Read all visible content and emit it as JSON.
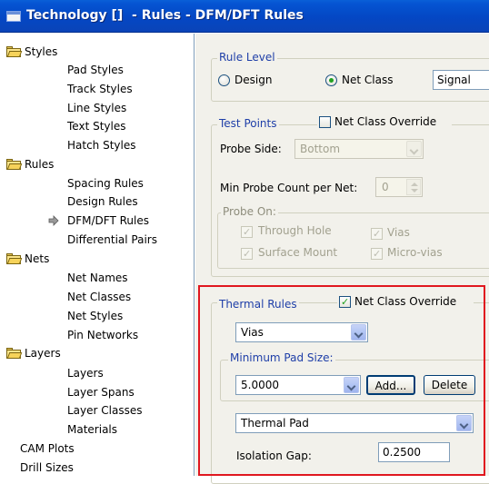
{
  "window": {
    "title": "Technology []  - Rules - DFM/DFT Rules"
  },
  "tree": {
    "styles": "Styles",
    "pad_styles": "Pad Styles",
    "track_styles": "Track Styles",
    "line_styles": "Line Styles",
    "text_styles": "Text Styles",
    "hatch_styles": "Hatch Styles",
    "rules": "Rules",
    "spacing_rules": "Spacing Rules",
    "design_rules": "Design Rules",
    "dfm_dft_rules": "DFM/DFT Rules",
    "differential_pairs": "Differential Pairs",
    "nets": "Nets",
    "net_names": "Net Names",
    "net_classes": "Net Classes",
    "net_styles": "Net Styles",
    "pin_networks": "Pin Networks",
    "layers": "Layers",
    "layers_item": "Layers",
    "layer_spans": "Layer Spans",
    "layer_classes": "Layer Classes",
    "materials": "Materials",
    "cam_plots": "CAM Plots",
    "drill_sizes": "Drill Sizes"
  },
  "rule_level": {
    "legend": "Rule Level",
    "design_label": "Design",
    "net_class_label": "Net Class",
    "selected": "Net Class",
    "net_class_value": "Signal"
  },
  "test_points": {
    "legend": "Test Points",
    "override_label": "Net Class Override",
    "override_checked": false,
    "probe_side_label": "Probe Side:",
    "probe_side_value": "Bottom",
    "min_probe_label": "Min Probe Count per Net:",
    "min_probe_value": "0",
    "probe_on": {
      "legend": "Probe On:",
      "through_hole": "Through Hole",
      "surface_mount": "Surface Mount",
      "vias": "Vias",
      "micro_vias": "Micro-vias"
    }
  },
  "thermal_rules": {
    "legend": "Thermal Rules",
    "override_label": "Net Class Override",
    "override_checked": true,
    "type_value": "Vias",
    "min_pad": {
      "legend": "Minimum Pad Size:",
      "value": "5.0000",
      "add_label": "Add...",
      "delete_label": "Delete"
    },
    "pad_type_value": "Thermal Pad",
    "isolation_gap_label": "Isolation Gap:",
    "isolation_gap_value": "0.2500"
  },
  "colors": {
    "titlebar": "#0447c4",
    "legend_text": "#1f3fa8",
    "highlight": "#e0171f",
    "panel_bg": "#f2f1eb"
  }
}
